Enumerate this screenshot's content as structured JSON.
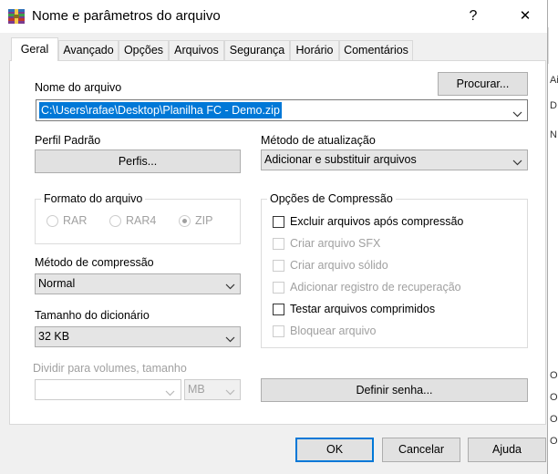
{
  "window": {
    "title": "Nome e parâmetros do arquivo",
    "help_glyph": "?",
    "close_glyph": "✕"
  },
  "tabs": [
    {
      "label": "Geral",
      "active": true
    },
    {
      "label": "Avançado"
    },
    {
      "label": "Opções"
    },
    {
      "label": "Arquivos"
    },
    {
      "label": "Segurança"
    },
    {
      "label": "Horário"
    },
    {
      "label": "Comentários"
    }
  ],
  "general": {
    "archive_name_label": "Nome do arquivo",
    "browse_label": "Procurar...",
    "archive_name_value": "C:\\Users\\rafae\\Desktop\\Planilha FC - Demo.zip",
    "profile_label": "Perfil Padrão",
    "profiles_button": "Perfis...",
    "update_method_label": "Método de atualização",
    "update_method_value": "Adicionar e substituir arquivos",
    "format_group": "Formato do arquivo",
    "formats": [
      {
        "label": "RAR",
        "selected": false
      },
      {
        "label": "RAR4",
        "selected": false
      },
      {
        "label": "ZIP",
        "selected": true
      }
    ],
    "compression_method_label": "Método de compressão",
    "compression_method_value": "Normal",
    "dictionary_size_label": "Tamanho do dicionário",
    "dictionary_size_value": "32 KB",
    "split_label": "Dividir para volumes, tamanho",
    "split_value": "",
    "split_unit": "MB",
    "compression_options_group": "Opções de Compressão",
    "options": [
      {
        "label": "Excluir arquivos após compressão",
        "enabled": true,
        "checked": false
      },
      {
        "label": "Criar arquivo SFX",
        "enabled": false,
        "checked": false
      },
      {
        "label": "Criar arquivo sólido",
        "enabled": false,
        "checked": false
      },
      {
        "label": "Adicionar registro de recuperação",
        "enabled": false,
        "checked": false
      },
      {
        "label": "Testar arquivos comprimidos",
        "enabled": true,
        "checked": false
      },
      {
        "label": "Bloquear arquivo",
        "enabled": false,
        "checked": false
      }
    ],
    "set_password_button": "Definir senha..."
  },
  "footer": {
    "ok": "OK",
    "cancel": "Cancelar",
    "help": "Ajuda"
  },
  "colors": {
    "selection": "#0078d7",
    "accent_border": "#0078d7",
    "disabled_text": "#a0a0a0"
  },
  "background_fragments": [
    "Ai",
    "D",
    "N",
    "O",
    "O",
    "O",
    "O"
  ]
}
